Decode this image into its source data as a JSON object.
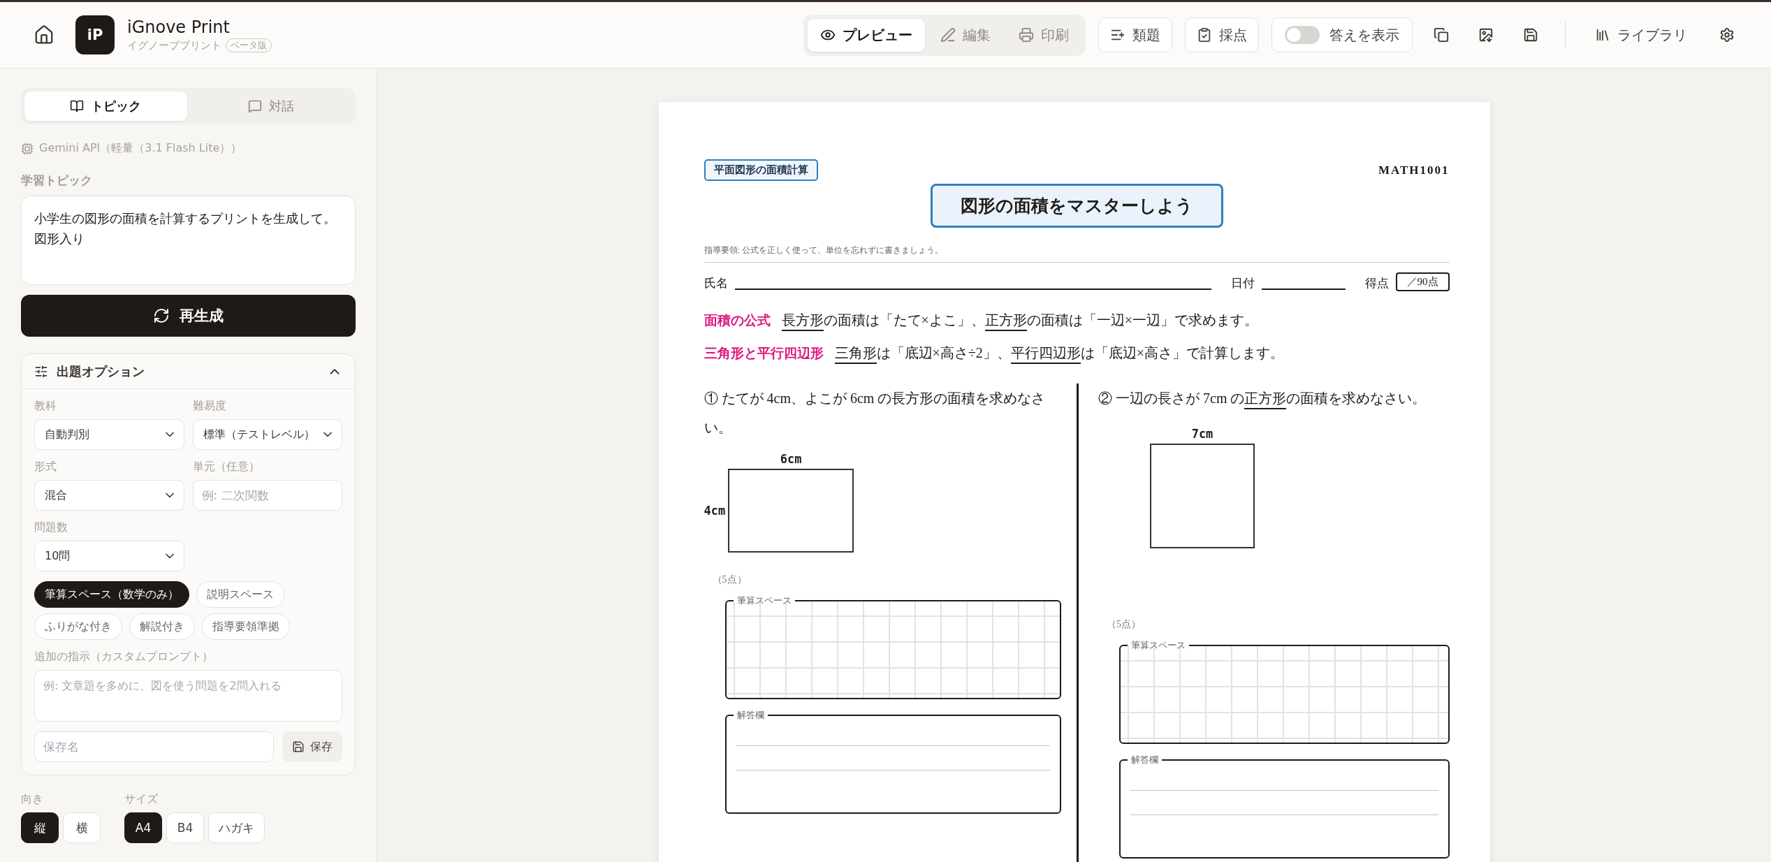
{
  "app": {
    "logo": "iP",
    "name": "iGnove Print",
    "subtitle": "イグノーブプリント",
    "badge": "ベータ版"
  },
  "toolbar": {
    "modes": [
      {
        "label": "プレビュー",
        "selected": true
      },
      {
        "label": "編集",
        "selected": false
      },
      {
        "label": "印刷",
        "selected": false
      }
    ],
    "buttons": [
      {
        "label": "類題"
      },
      {
        "label": "採点"
      }
    ],
    "answer_toggle": {
      "label": "答えを表示",
      "on": false
    },
    "library": "ライブラリ"
  },
  "sidebar": {
    "tabs": [
      {
        "label": "トピック",
        "selected": true
      },
      {
        "label": "対話",
        "selected": false
      }
    ],
    "model": "Gemini API（軽量（3.1 Flash Lite））",
    "topic": {
      "label": "学習トピック",
      "value": "小学生の図形の面積を計算するプリントを生成して。図形入り"
    },
    "regenerate": "再生成",
    "options": {
      "title": "出題オプション",
      "expanded": true,
      "fields": [
        {
          "kind": "select",
          "label": "教科",
          "value": "自動判別"
        },
        {
          "kind": "select",
          "label": "難易度",
          "value": "標準（テストレベル）"
        },
        {
          "kind": "select",
          "label": "形式",
          "value": "混合"
        },
        {
          "kind": "input",
          "label": "単元（任意）",
          "placeholder": "例: 二次関数"
        },
        {
          "kind": "select",
          "label": "問題数",
          "value": "10問"
        }
      ],
      "chips": [
        {
          "label": "筆算スペース（数学のみ）",
          "selected": true
        },
        {
          "label": "説明スペース",
          "selected": false
        },
        {
          "label": "ふりがな付き",
          "selected": false
        },
        {
          "label": "解説付き",
          "selected": false
        },
        {
          "label": "指導要領準拠",
          "selected": false
        }
      ],
      "custom": {
        "label": "追加の指示（カスタムプロンプト）",
        "placeholder": "例: 文章題を多めに、図を使う問題を2問入れる"
      },
      "save_name": {
        "placeholder": "保存名"
      },
      "save_button": "保存"
    },
    "orientation": {
      "label": "向き",
      "options": [
        {
          "label": "縦",
          "selected": true
        },
        {
          "label": "横",
          "selected": false
        }
      ]
    },
    "size": {
      "label": "サイズ",
      "options": [
        {
          "label": "A4",
          "selected": true
        },
        {
          "label": "B4",
          "selected": false
        },
        {
          "label": "ハガキ",
          "selected": false
        }
      ]
    }
  },
  "worksheet": {
    "tag": "平面図形の面積計算",
    "code": "MATH1001",
    "title": "図形の面積をマスターしよう",
    "guidance": "指導要領: 公式を正しく使って、単位を忘れずに書きましょう。",
    "name_label": "氏名",
    "date_label": "日付",
    "score_label": "得点",
    "score_total": "／90点",
    "formulas": [
      {
        "heading": "面積の公式",
        "segments": [
          {
            "text": "長方形",
            "underline": true
          },
          {
            "text": "の面積は「たて×よこ」、",
            "underline": false
          },
          {
            "text": "正方形",
            "underline": true
          },
          {
            "text": "の面積は「一辺×一辺」で求めます。",
            "underline": false
          }
        ]
      },
      {
        "heading": "三角形と平行四辺形",
        "segments": [
          {
            "text": "三角形",
            "underline": true
          },
          {
            "text": "は「底辺×高さ÷2」、",
            "underline": false
          },
          {
            "text": "平行四辺形",
            "underline": true
          },
          {
            "text": "は「底辺×高さ」で計算します。",
            "underline": false
          }
        ]
      }
    ],
    "questions": [
      {
        "number": "①",
        "segments": [
          {
            "text": "たてが 4cm、よこが 6cm の長方形の面積を求めなさい。",
            "underline": false
          }
        ],
        "figure": {
          "kind": "rectangle",
          "top_label": "6cm",
          "side_label": "4cm"
        },
        "points": "（5点）",
        "work_label": "筆算スペース",
        "answer_label": "解答欄"
      },
      {
        "number": "②",
        "segments": [
          {
            "text": "一辺の長さが 7cm の",
            "underline": false
          },
          {
            "text": "正方形",
            "underline": true
          },
          {
            "text": "の面積を求めなさい。",
            "underline": false
          }
        ],
        "figure": {
          "kind": "square",
          "top_label": "7cm"
        },
        "points": "（5点）",
        "work_label": "筆算スペース",
        "answer_label": "解答欄"
      }
    ]
  }
}
